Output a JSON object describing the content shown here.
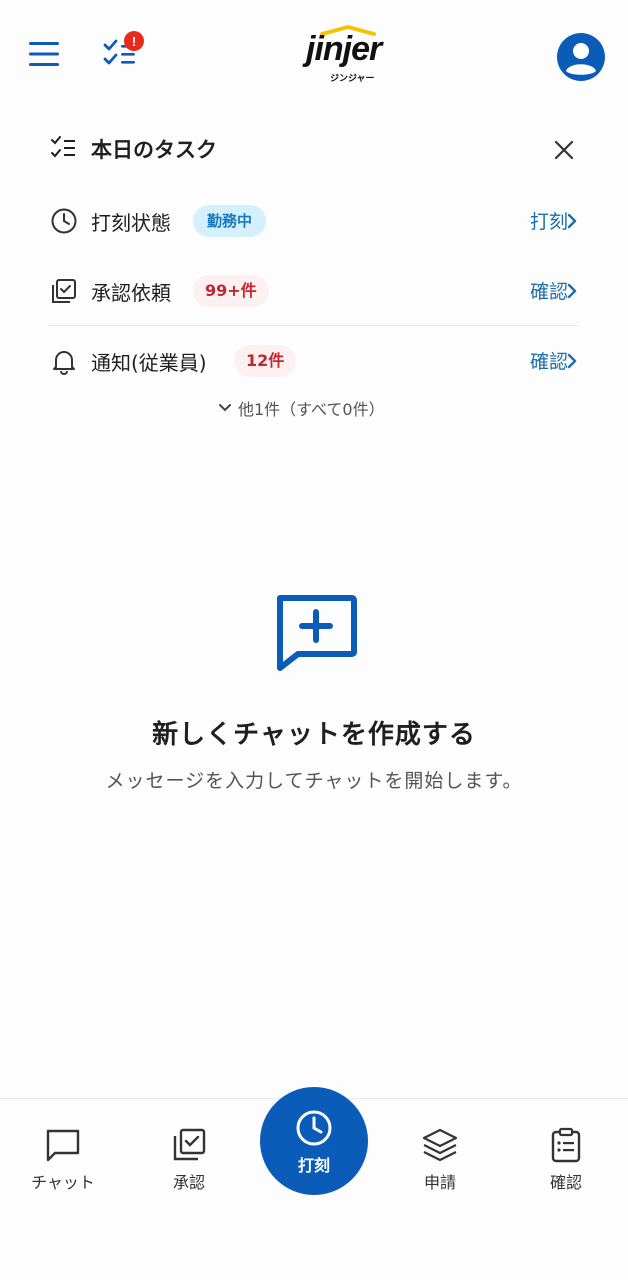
{
  "header": {
    "menu_icon": "hamburger-menu-icon",
    "task_icon": "checklist-icon",
    "task_badge": "!",
    "logo_text": "jinjer",
    "logo_sub": "ジンジャー",
    "avatar_icon": "user-avatar-icon"
  },
  "tasks": {
    "title": "本日のタスク",
    "rows": [
      {
        "icon": "clock-icon",
        "label": "打刻状態",
        "pill": "勤務中",
        "action": "打刻"
      },
      {
        "icon": "approval-check-icon",
        "label": "承認依頼",
        "pill": "99+件",
        "action": "確認"
      },
      {
        "icon": "bell-icon",
        "label": "通知(従業員)",
        "pill": "12件",
        "action": "確認"
      }
    ],
    "more": "他1件（すべて0件）"
  },
  "empty": {
    "title": "新しくチャットを作成する",
    "description": "メッセージを入力してチャットを開始します。"
  },
  "nav": {
    "items": [
      {
        "icon": "chat-icon",
        "label": "チャット"
      },
      {
        "icon": "approval-icon",
        "label": "承認"
      },
      {
        "icon": "clock-icon",
        "label": "打刻"
      },
      {
        "icon": "layers-icon",
        "label": "申請"
      },
      {
        "icon": "clipboard-icon",
        "label": "確認"
      }
    ]
  },
  "colors": {
    "primary": "#0a5cb8",
    "link": "#1d6fa8",
    "badge_red": "#e62b1e",
    "pill_blue_bg": "#d4effd"
  }
}
